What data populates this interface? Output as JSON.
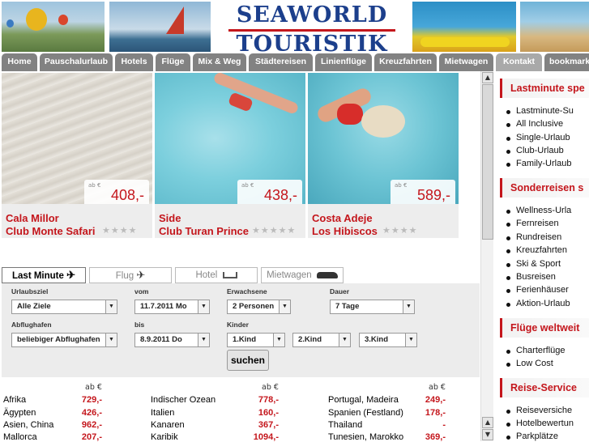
{
  "header": {
    "logo_line1": "SEAWORLD",
    "logo_line2": "TOURISTIK"
  },
  "nav": {
    "tabs": [
      "Home",
      "Pauschalurlaub",
      "Hotels",
      "Flüge",
      "Mix & Weg",
      "Städtereisen",
      "Linienflüge",
      "Kreuzfahrten",
      "Mietwagen",
      "Kontakt",
      "bookmark"
    ],
    "active": "Kontakt"
  },
  "offers": [
    {
      "ab": "ab €",
      "price": "408,-",
      "place": "Cala Millor",
      "hotel": "Club Monte Safari",
      "stars": "★★★★"
    },
    {
      "ab": "ab €",
      "price": "438,-",
      "place": "Side",
      "hotel": "Club Turan Prince",
      "stars": "★★★★★"
    },
    {
      "ab": "ab €",
      "price": "589,-",
      "place": "Costa Adeje",
      "hotel": "Los Hibiscos",
      "stars": "★★★★"
    }
  ],
  "search": {
    "tabs": [
      {
        "label": "Last Minute",
        "icon": "plane-icon"
      },
      {
        "label": "Flug",
        "icon": "plane-icon"
      },
      {
        "label": "Hotel",
        "icon": "bed-icon"
      },
      {
        "label": "Mietwagen",
        "icon": "car-icon"
      }
    ],
    "fields": {
      "urlaubsziel": {
        "label": "Urlaubsziel",
        "value": "Alle Ziele"
      },
      "vom": {
        "label": "vom",
        "value": "11.7.2011 Mo"
      },
      "erwachsene": {
        "label": "Erwachsene",
        "value": "2 Personen"
      },
      "dauer": {
        "label": "Dauer",
        "value": "7 Tage"
      },
      "abflughafen": {
        "label": "Abflughafen",
        "value": "beliebiger Abflughafen"
      },
      "bis": {
        "label": "bis",
        "value": "8.9.2011 Do"
      },
      "kinder": {
        "label": "Kinder",
        "kind1": "1.Kind",
        "kind2": "2.Kind",
        "kind3": "3.Kind"
      }
    },
    "button": "suchen"
  },
  "destinations": {
    "head": "ab €",
    "col1": [
      {
        "name": "Afrika",
        "price": "729,-"
      },
      {
        "name": "Ägypten",
        "price": "426,-"
      },
      {
        "name": "Asien, China",
        "price": "962,-"
      },
      {
        "name": "Mallorca",
        "price": "207,-"
      }
    ],
    "col2": [
      {
        "name": "Indischer Ozean",
        "price": "778,-"
      },
      {
        "name": "Italien",
        "price": "160,-"
      },
      {
        "name": "Kanaren",
        "price": "367,-"
      },
      {
        "name": "Karibik",
        "price": "1094,-"
      }
    ],
    "col3": [
      {
        "name": "Portugal, Madeira",
        "price": "249,-"
      },
      {
        "name": "Spanien (Festland)",
        "price": "178,-"
      },
      {
        "name": "Thailand",
        "price": "-"
      },
      {
        "name": "Tunesien, Marokko",
        "price": "369,-"
      }
    ]
  },
  "sidebar": {
    "sections": [
      {
        "title": "Lastminute spe",
        "items": [
          "Lastminute-Su",
          "All Inclusive",
          "Single-Urlaub",
          "Club-Urlaub",
          "Family-Urlaub"
        ]
      },
      {
        "title": "Sonderreisen s",
        "items": [
          "Wellness-Urla",
          "Fernreisen",
          "Rundreisen",
          "Kreuzfahrten",
          "Ski & Sport",
          "Busreisen",
          "Ferienhäuser",
          "Aktion-Urlaub"
        ]
      },
      {
        "title": "Flüge weltweit",
        "items": [
          "Charterflüge",
          "Low Cost"
        ]
      },
      {
        "title": "Reise-Service",
        "items": [
          "Reiseversiche",
          "Hotelbewertun",
          "Parkplätze"
        ]
      }
    ]
  },
  "colors": {
    "accent": "#c4161c",
    "brand": "#1c3f8c",
    "tab": "#828282"
  }
}
